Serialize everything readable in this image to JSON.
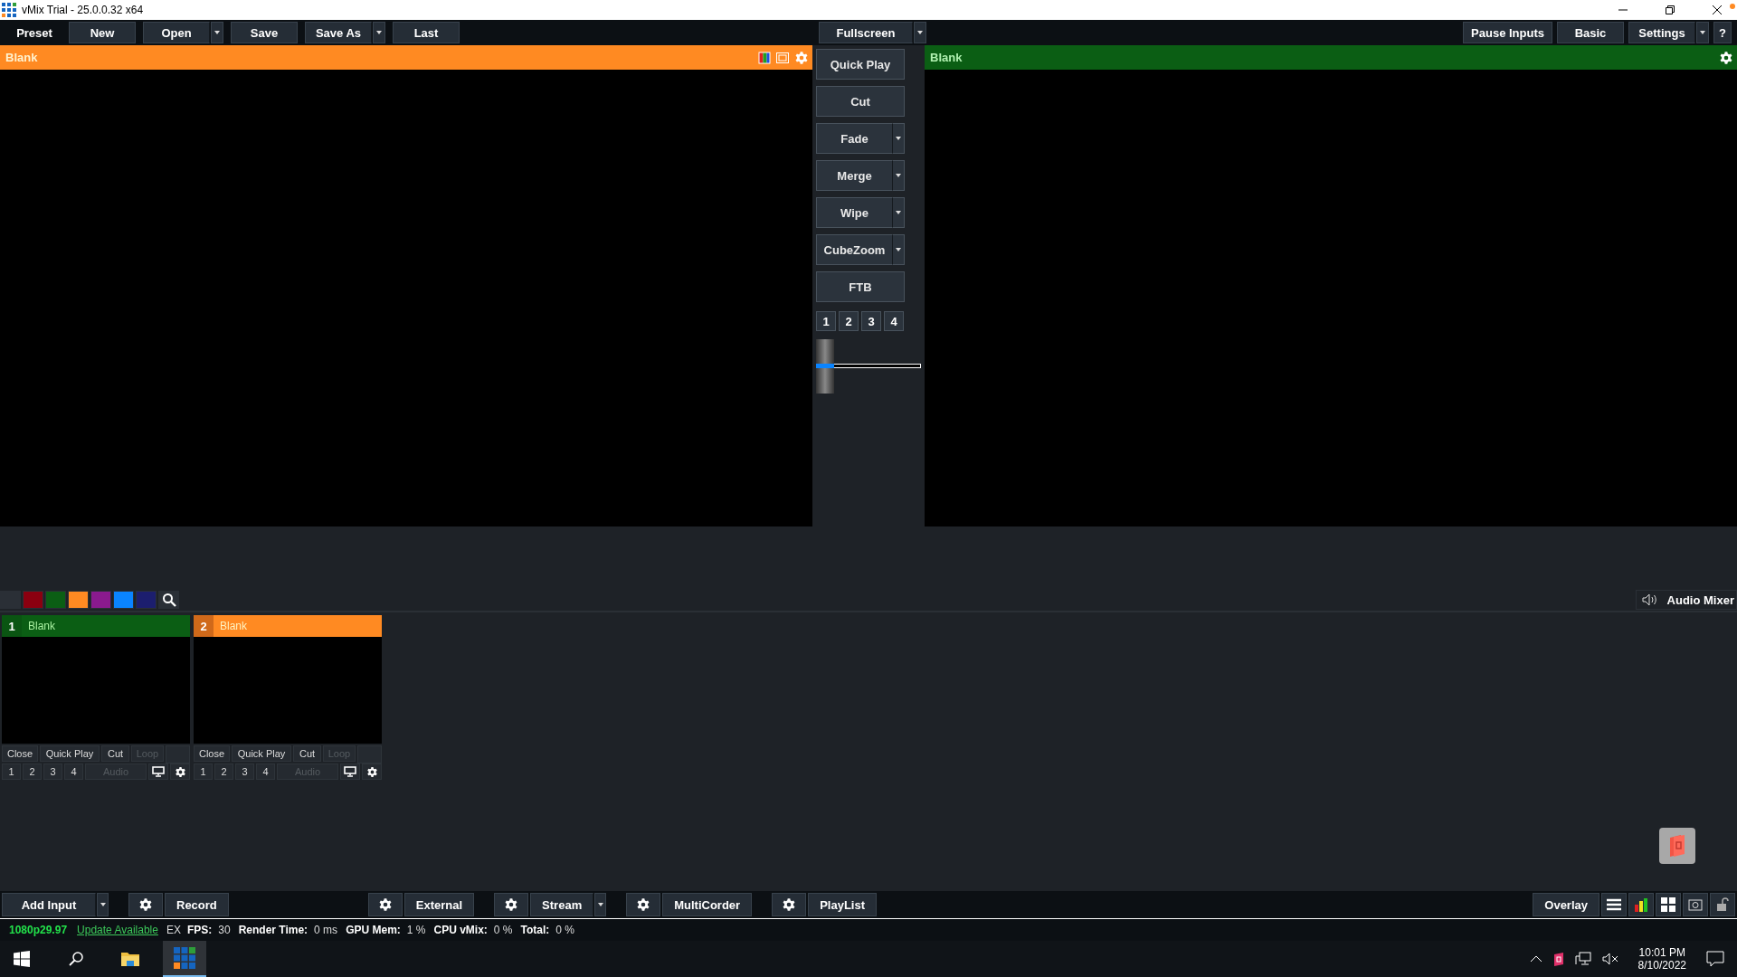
{
  "window": {
    "title": "vMix Trial - 25.0.0.32 x64"
  },
  "toolbar": {
    "left": [
      {
        "label": "Preset",
        "kind": "plain",
        "dropdown": false
      },
      {
        "label": "New",
        "kind": "button",
        "dropdown": false
      },
      {
        "label": "Open",
        "kind": "button",
        "dropdown": true
      },
      {
        "label": "Save",
        "kind": "button",
        "dropdown": false
      },
      {
        "label": "Save As",
        "kind": "button",
        "dropdown": true
      },
      {
        "label": "Last",
        "kind": "button",
        "dropdown": false
      }
    ],
    "center": {
      "label": "Fullscreen",
      "dropdown": true
    },
    "right": [
      {
        "label": "Pause Inputs",
        "dropdown": false
      },
      {
        "label": "Basic",
        "dropdown": false
      },
      {
        "label": "Settings",
        "dropdown": true
      },
      {
        "label": "?",
        "dropdown": false
      }
    ]
  },
  "preview": {
    "title": "Blank"
  },
  "program": {
    "title": "Blank"
  },
  "transitions": [
    {
      "label": "Quick Play",
      "dropdown": false
    },
    {
      "label": "Cut",
      "dropdown": false
    },
    {
      "label": "Fade",
      "dropdown": true
    },
    {
      "label": "Merge",
      "dropdown": true
    },
    {
      "label": "Wipe",
      "dropdown": true
    },
    {
      "label": "CubeZoom",
      "dropdown": true
    },
    {
      "label": "FTB",
      "dropdown": false
    }
  ],
  "transition_numbers": [
    "1",
    "2",
    "3",
    "4"
  ],
  "color_filters": [
    {
      "color": "#2a2f36"
    },
    {
      "color": "#8b0010"
    },
    {
      "color": "#0b5e14"
    },
    {
      "color": "#ff8a22"
    },
    {
      "color": "#8a1a8e"
    },
    {
      "color": "#0a84ff"
    },
    {
      "color": "#1c1e6e"
    }
  ],
  "audio_mixer": {
    "label": "Audio Mixer"
  },
  "inputs": [
    {
      "number": "1",
      "title": "Blank",
      "live": true,
      "buttons": [
        {
          "label": "Close",
          "disabled": false
        },
        {
          "label": "Quick Play",
          "disabled": false
        },
        {
          "label": "Cut",
          "disabled": false
        },
        {
          "label": "Loop",
          "disabled": true
        }
      ],
      "numbers": [
        "1",
        "2",
        "3",
        "4"
      ],
      "audio": {
        "label": "Audio",
        "disabled": true
      }
    },
    {
      "number": "2",
      "title": "Blank",
      "live": false,
      "buttons": [
        {
          "label": "Close",
          "disabled": false
        },
        {
          "label": "Quick Play",
          "disabled": false
        },
        {
          "label": "Cut",
          "disabled": false
        },
        {
          "label": "Loop",
          "disabled": true
        }
      ],
      "numbers": [
        "1",
        "2",
        "3",
        "4"
      ],
      "audio": {
        "label": "Audio",
        "disabled": true
      }
    }
  ],
  "bottom_bar": [
    {
      "label": "Add Input",
      "gear": false,
      "dropdown": true
    },
    {
      "label": "Record",
      "gear": true,
      "dropdown": false
    },
    {
      "label": "External",
      "gear": true,
      "dropdown": false
    },
    {
      "label": "Stream",
      "gear": true,
      "dropdown": true
    },
    {
      "label": "MultiCorder",
      "gear": true,
      "dropdown": false
    },
    {
      "label": "PlayList",
      "gear": true,
      "dropdown": false
    }
  ],
  "overlay": {
    "label": "Overlay"
  },
  "status_bar": {
    "format": "1080p29.97",
    "update_link": "Update Available",
    "mode": "EX",
    "stats": [
      {
        "label": "FPS:",
        "value": "30"
      },
      {
        "label": "Render Time:",
        "value": "0 ms"
      },
      {
        "label": "GPU Mem:",
        "value": "1 %"
      },
      {
        "label": "CPU vMix:",
        "value": "0 %"
      },
      {
        "label": "Total:",
        "value": "0 %"
      }
    ]
  },
  "taskbar": {
    "time": "10:01 PM",
    "date": "8/10/2022"
  }
}
